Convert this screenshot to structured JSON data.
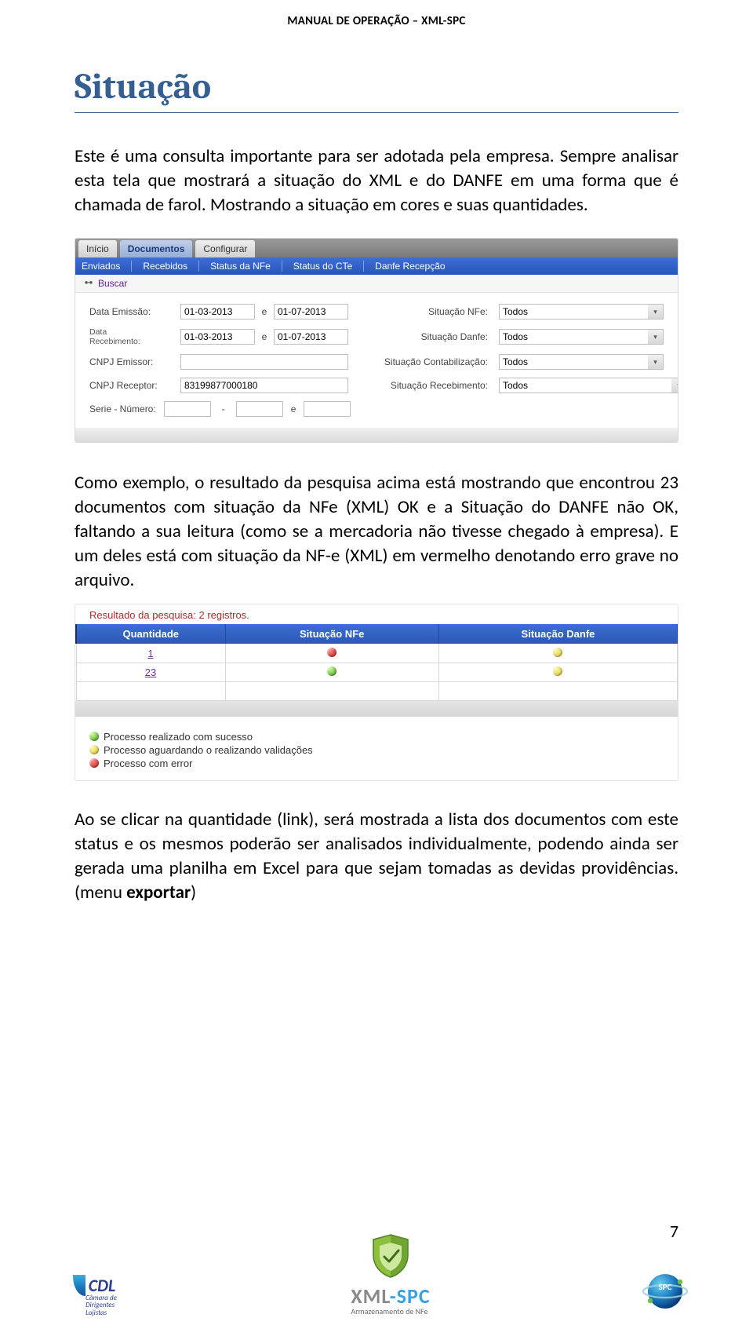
{
  "header": {
    "title": "MANUAL DE OPERAÇÃO – XML-SPC"
  },
  "section": {
    "title": "Situação"
  },
  "para1": "Este é uma consulta importante para ser adotada pela empresa. Sempre analisar esta tela que mostrará a situação do XML e do DANFE em uma forma que é chamada de farol. Mostrando a situação em cores e suas quantidades.",
  "shot1": {
    "tabs": [
      "Início",
      "Documentos",
      "Configurar"
    ],
    "bluebar": [
      "Enviados",
      "Recebidos",
      "Status da NFe",
      "Status do CTe",
      "Danfe Recepção"
    ],
    "buscar": "Buscar",
    "labels": {
      "data_emissao": "Data Emissão:",
      "data_recebimento_a": "Data",
      "data_recebimento_b": "Recebimento:",
      "cnpj_emissor": "CNPJ Emissor:",
      "cnpj_receptor": "CNPJ Receptor:",
      "serie_numero": "Serie - Número:",
      "sit_nfe": "Situação NFe:",
      "sit_danfe": "Situação Danfe:",
      "sit_contab": "Situação Contabilização:",
      "sit_receb": "Situação Recebimento:",
      "e": "e"
    },
    "values": {
      "de_emissao": "01-03-2013",
      "ate_emissao": "01-07-2013",
      "de_receb": "01-03-2013",
      "ate_receb": "01-07-2013",
      "cnpj_emissor": "",
      "cnpj_receptor": "83199877000180",
      "serie": "",
      "numero_de": "",
      "numero_ate": "",
      "sel_todos": "Todos"
    }
  },
  "para2": "Como exemplo, o resultado da pesquisa acima está mostrando que encontrou 23 documentos com situação da NFe (XML) OK e a Situação do DANFE não OK, faltando a sua leitura (como se a mercadoria não tivesse chegado à empresa). E um deles está com situação da NF-e (XML) em vermelho denotando erro grave no arquivo.",
  "shot2": {
    "result_header": "Resultado da pesquisa: 2 registros.",
    "cols": [
      "Quantidade",
      "Situação NFe",
      "Situação Danfe"
    ],
    "rows": [
      {
        "q": "1",
        "nfe": "red",
        "danfe": "yellow"
      },
      {
        "q": "23",
        "nfe": "green",
        "danfe": "yellow"
      }
    ],
    "legend": [
      {
        "color": "green",
        "text": "Processo realizado com sucesso"
      },
      {
        "color": "yellow",
        "text": "Processo aguardando o realizando validações"
      },
      {
        "color": "red",
        "text": "Processo com error"
      }
    ]
  },
  "para3_pre": "Ao se clicar na quantidade (link), será mostrada a lista dos documentos com este status e os mesmos poderão ser analisados individualmente, podendo ainda ser gerada uma planilha em Excel para que sejam tomadas as devidas providências. (menu ",
  "para3_bold": "exportar",
  "para3_post": ")",
  "page_number": "7",
  "footer": {
    "cdl_line1": "CDL",
    "cdl_sub": "Câmara de\nDirigentes\nLojistas",
    "xml": "XML",
    "spc": "-SPC",
    "xmlspc_sub": "Armazenamento de NFe",
    "spc_globe": "SPC"
  }
}
